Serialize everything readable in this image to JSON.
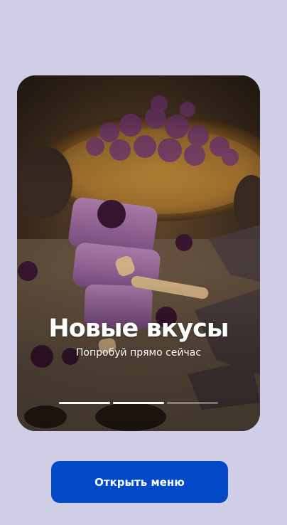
{
  "story": {
    "title": "Новые вкусы",
    "subtitle": "Попробуй прямо сейчас",
    "image": "berry-ice-cream-popsicles-photo",
    "progress": [
      1,
      1,
      0
    ]
  },
  "actions": {
    "open_menu_label": "Открыть меню"
  },
  "colors": {
    "background": "#d0cee6",
    "button": "#0249c8",
    "text_on_image": "#ffffff"
  }
}
